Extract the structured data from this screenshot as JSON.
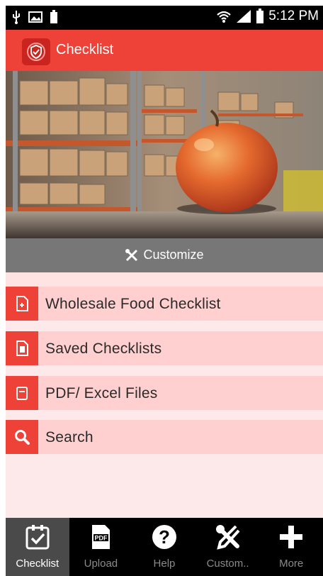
{
  "status_bar": {
    "time": "5:12 PM"
  },
  "app_bar": {
    "title": "Checklist"
  },
  "banner": {
    "customize_label": "Customize"
  },
  "menu": {
    "items": [
      {
        "label": "Wholesale Food Checklist",
        "icon": "new-document-icon"
      },
      {
        "label": "Saved Checklists",
        "icon": "saved-document-icon"
      },
      {
        "label": "PDF/ Excel Files",
        "icon": "file-icon"
      },
      {
        "label": "Search",
        "icon": "search-icon"
      }
    ]
  },
  "bottom_nav": {
    "items": [
      {
        "label": "Checklist",
        "icon": "checklist-icon",
        "active": true
      },
      {
        "label": "Upload",
        "icon": "pdf-icon"
      },
      {
        "label": "Help",
        "icon": "help-icon"
      },
      {
        "label": "Custom..",
        "icon": "tools-icon"
      },
      {
        "label": "More",
        "icon": "plus-icon"
      }
    ]
  },
  "colors": {
    "accent": "#ee4138",
    "menu_item_bg": "#ffd0cf",
    "page_bg": "#fde9e9",
    "nav_bg": "#000000"
  }
}
